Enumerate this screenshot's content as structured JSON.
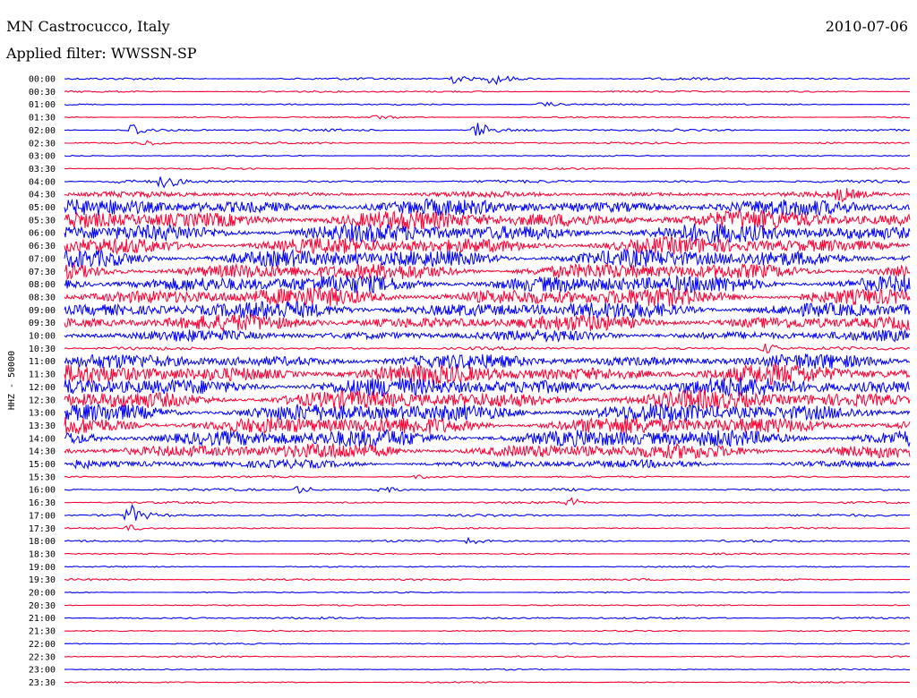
{
  "header": {
    "station": "MN Castrocucco, Italy",
    "filter": "Applied filter: WWSSN-SP",
    "date": "2010-07-06"
  },
  "chart_data": {
    "type": "line",
    "subtype": "helicorder",
    "ylabel": "HHZ - 50000",
    "colors": {
      "even": "#0000ff",
      "odd": "#ff0033"
    },
    "rows": [
      {
        "label": "00:00",
        "amp": 1.5,
        "events": [
          [
            0.46,
            5
          ],
          [
            0.51,
            7
          ]
        ]
      },
      {
        "label": "00:30",
        "amp": 1.2,
        "events": []
      },
      {
        "label": "01:00",
        "amp": 1.0,
        "events": [
          [
            0.57,
            3
          ]
        ]
      },
      {
        "label": "01:30",
        "amp": 1.0,
        "events": [
          [
            0.37,
            2
          ]
        ]
      },
      {
        "label": "02:00",
        "amp": 1.5,
        "events": [
          [
            0.08,
            9
          ],
          [
            0.49,
            10
          ]
        ]
      },
      {
        "label": "02:30",
        "amp": 1.3,
        "events": [
          [
            0.1,
            3
          ]
        ]
      },
      {
        "label": "03:00",
        "amp": 0.9,
        "events": []
      },
      {
        "label": "03:30",
        "amp": 1.1,
        "events": []
      },
      {
        "label": "04:00",
        "amp": 1.8,
        "events": [
          [
            0.06,
            2
          ],
          [
            0.12,
            7
          ]
        ]
      },
      {
        "label": "04:30",
        "amp": 3.5,
        "events": [
          [
            0.92,
            6
          ]
        ]
      },
      {
        "label": "05:00",
        "amp": 10,
        "events": []
      },
      {
        "label": "05:30",
        "amp": 12,
        "events": []
      },
      {
        "label": "06:00",
        "amp": 12,
        "events": []
      },
      {
        "label": "06:30",
        "amp": 11,
        "events": []
      },
      {
        "label": "07:00",
        "amp": 12,
        "events": []
      },
      {
        "label": "07:30",
        "amp": 11,
        "events": []
      },
      {
        "label": "08:00",
        "amp": 12,
        "events": []
      },
      {
        "label": "08:30",
        "amp": 12,
        "events": []
      },
      {
        "label": "09:00",
        "amp": 11,
        "events": []
      },
      {
        "label": "09:30",
        "amp": 10,
        "events": []
      },
      {
        "label": "10:00",
        "amp": 7,
        "events": []
      },
      {
        "label": "10:30",
        "amp": 2,
        "events": [
          [
            0.83,
            6
          ]
        ]
      },
      {
        "label": "11:00",
        "amp": 9,
        "events": []
      },
      {
        "label": "11:30",
        "amp": 12,
        "events": []
      },
      {
        "label": "12:00",
        "amp": 12,
        "events": []
      },
      {
        "label": "12:30",
        "amp": 12,
        "events": []
      },
      {
        "label": "13:00",
        "amp": 12,
        "events": []
      },
      {
        "label": "13:30",
        "amp": 12,
        "events": []
      },
      {
        "label": "14:00",
        "amp": 12,
        "events": []
      },
      {
        "label": "14:30",
        "amp": 10,
        "events": []
      },
      {
        "label": "15:00",
        "amp": 5,
        "events": [
          [
            0.02,
            5
          ]
        ]
      },
      {
        "label": "15:30",
        "amp": 1.2,
        "events": [
          [
            0.42,
            2
          ]
        ]
      },
      {
        "label": "16:00",
        "amp": 1.5,
        "events": [
          [
            0.28,
            5
          ],
          [
            0.38,
            3
          ]
        ]
      },
      {
        "label": "16:30",
        "amp": 1.3,
        "events": [
          [
            0.6,
            6
          ]
        ]
      },
      {
        "label": "17:00",
        "amp": 1.5,
        "events": [
          [
            0.08,
            10
          ]
        ]
      },
      {
        "label": "17:30",
        "amp": 1.0,
        "events": [
          [
            0.08,
            3
          ]
        ]
      },
      {
        "label": "18:00",
        "amp": 1.4,
        "events": [
          [
            0.48,
            4
          ]
        ]
      },
      {
        "label": "18:30",
        "amp": 1.0,
        "events": []
      },
      {
        "label": "19:00",
        "amp": 0.9,
        "events": []
      },
      {
        "label": "19:30",
        "amp": 1.3,
        "events": []
      },
      {
        "label": "20:00",
        "amp": 0.9,
        "events": []
      },
      {
        "label": "20:30",
        "amp": 0.9,
        "events": []
      },
      {
        "label": "21:00",
        "amp": 1.3,
        "events": []
      },
      {
        "label": "21:30",
        "amp": 0.9,
        "events": []
      },
      {
        "label": "22:00",
        "amp": 0.8,
        "events": []
      },
      {
        "label": "22:30",
        "amp": 1.0,
        "events": []
      },
      {
        "label": "23:00",
        "amp": 0.8,
        "events": []
      },
      {
        "label": "23:30",
        "amp": 0.9,
        "events": []
      }
    ]
  }
}
